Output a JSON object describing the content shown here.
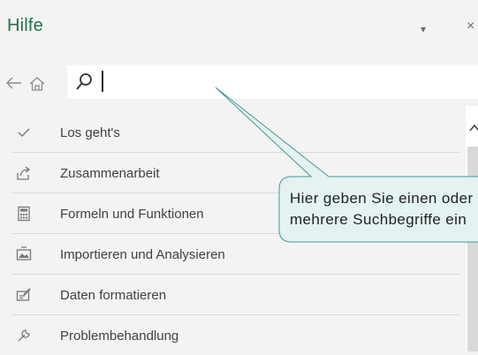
{
  "header": {
    "title": "Hilfe",
    "dropdown_glyph": "▾",
    "close_glyph": "×"
  },
  "nav": {
    "back_icon": "back-arrow-icon",
    "home_icon": "home-icon"
  },
  "search": {
    "value": "",
    "icon": "search-icon"
  },
  "topics": [
    {
      "label": "Los geht's",
      "icon": "checkmark-icon"
    },
    {
      "label": "Zusammenarbeit",
      "icon": "share-icon"
    },
    {
      "label": "Formeln und Funktionen",
      "icon": "calculator-icon"
    },
    {
      "label": "Importieren und Analysieren",
      "icon": "import-image-icon"
    },
    {
      "label": "Daten formatieren",
      "icon": "format-icon"
    },
    {
      "label": "Problembehandlung",
      "icon": "wrench-icon"
    }
  ],
  "callout": {
    "line1": "Hier geben Sie einen oder",
    "line2": "mehrere Suchbegriffe ein"
  },
  "colors": {
    "title": "#217346",
    "callout_fill": "#e4f2f1",
    "callout_border": "#3f9a98"
  }
}
